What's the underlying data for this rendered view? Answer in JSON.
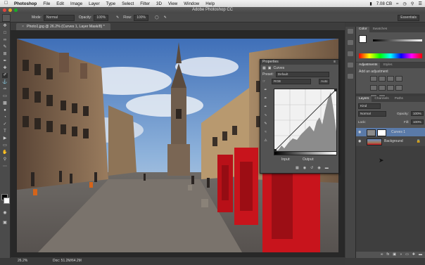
{
  "menubar": {
    "app_name": "Photoshop",
    "items": [
      "File",
      "Edit",
      "Image",
      "Layer",
      "Type",
      "Select",
      "Filter",
      "3D",
      "View",
      "Window",
      "Help"
    ],
    "battery": "7.08 CB",
    "right_icons": [
      "battery-icon",
      "wifi-icon",
      "clock-icon",
      "search-icon",
      "list-icon"
    ]
  },
  "window": {
    "title": "Adobe Photoshop CC"
  },
  "options_bar": {
    "mode_label": "Mode:",
    "mode_value": "Normal",
    "opacity_label": "Opacity:",
    "opacity_value": "100%",
    "flow_label": "Flow:",
    "flow_value": "100%",
    "workspace": "Essentials"
  },
  "document": {
    "tab_title": "Photo1.jpg @ 26.2% (Curves 1, Layer Mask/8) *",
    "zoom": "26.2%",
    "doc_info": "Doc: 51.2M/64.2M"
  },
  "properties": {
    "title": "Properties",
    "adjustment_name": "Curves",
    "preset_label": "Preset:",
    "preset_value": "Default",
    "channel_value": "RGB",
    "auto_label": "Auto",
    "input_label": "Input:",
    "output_label": "Output:"
  },
  "panels": {
    "color_tabs": [
      "Color",
      "Swatches"
    ],
    "adjustments_tabs": [
      "Adjustments",
      "Styles"
    ],
    "add_adjustment_label": "Add an adjustment",
    "layers_tabs": [
      "Layers",
      "Channels",
      "Paths"
    ],
    "kind_label": "Kind",
    "blend_mode": "Normal",
    "opacity_label": "Opacity:",
    "opacity_value": "100%",
    "lock_label": "Lock:",
    "fill_label": "Fill:",
    "fill_value": "100%",
    "layers": [
      {
        "name": "Curves 1",
        "selected": true
      },
      {
        "name": "Background",
        "selected": false
      }
    ]
  },
  "colors": {
    "accent_selected": "#5a7aa8",
    "phone_box_red": "#c8141c"
  }
}
